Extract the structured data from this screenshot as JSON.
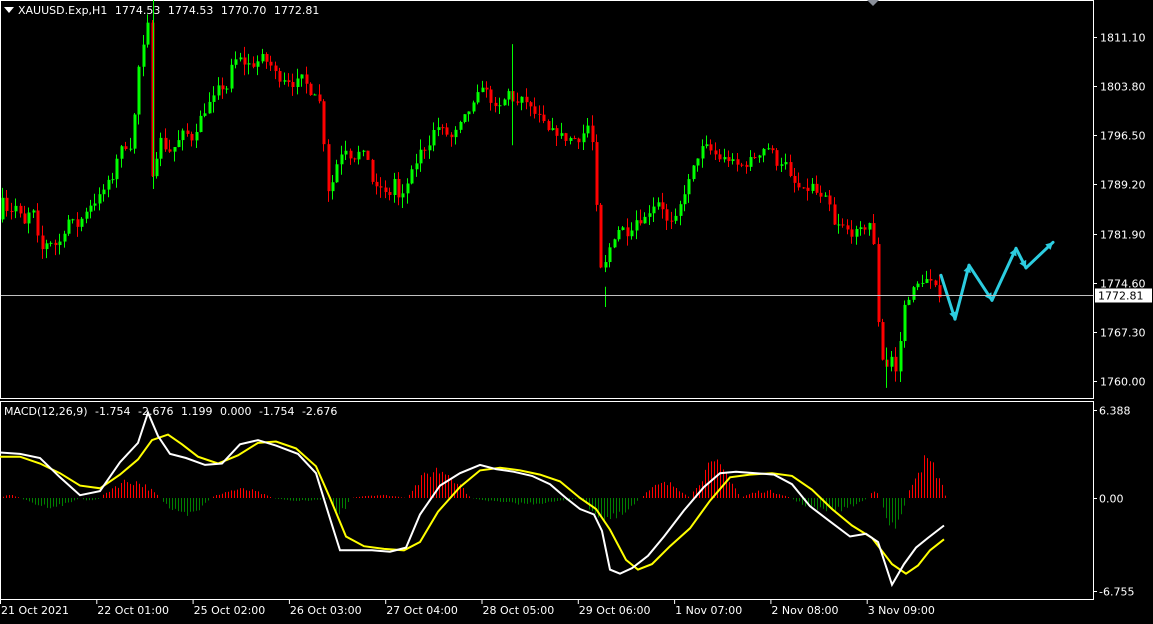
{
  "header": {
    "symbol": "XAUUSD.Exp,H1",
    "open": "1774.53",
    "high": "1774.53",
    "low": "1770.70",
    "close": "1772.81"
  },
  "indicator": {
    "name": "MACD(12,26,9)",
    "values": [
      "-1.754",
      "-2.676",
      "1.199",
      "0.000",
      "-1.754",
      "-2.676"
    ]
  },
  "colors": {
    "background": "#000000",
    "grid": "#ffffff",
    "bull_candle": "#00ff00",
    "bear_candle": "#ff0000",
    "bid_line": "#c0c0c0",
    "macd_line": "#ffffff",
    "signal_line": "#ffff00",
    "hist_positive": "#ff0000",
    "hist_negative": "#008000",
    "forecast_arrow": "#2ccde0"
  },
  "chart_data": [
    {
      "type": "candlestick",
      "symbol": "XAUUSD.Exp",
      "timeframe": "H1",
      "current_price": 1772.81,
      "current_price_label": "1772.81",
      "ylim": [
        1757.5,
        1816.4
      ],
      "y_tick_labels": [
        "1811.10",
        "1803.80",
        "1796.50",
        "1789.20",
        "1781.90",
        "1774.60",
        "1767.30",
        "1760.00"
      ],
      "x_tick_labels": [
        "21 Oct 2021",
        "22 Oct 01:00",
        "25 Oct 02:00",
        "26 Oct 03:00",
        "27 Oct 04:00",
        "28 Oct 05:00",
        "29 Oct 06:00",
        "1 Nov 07:00",
        "2 Nov 08:00",
        "3 Nov 09:00"
      ],
      "close_path": [
        [
          0,
          1782
        ],
        [
          6,
          1788
        ],
        [
          12,
          1785
        ],
        [
          20,
          1786
        ],
        [
          28,
          1783
        ],
        [
          36,
          1786
        ],
        [
          44,
          1779
        ],
        [
          52,
          1781
        ],
        [
          62,
          1780
        ],
        [
          72,
          1784
        ],
        [
          82,
          1783
        ],
        [
          92,
          1786
        ],
        [
          102,
          1787
        ],
        [
          110,
          1789
        ],
        [
          116,
          1790
        ],
        [
          122,
          1794
        ],
        [
          130,
          1795
        ],
        [
          136,
          1795
        ],
        [
          142,
          1806
        ],
        [
          148,
          1810
        ],
        [
          152,
          1813
        ],
        [
          154,
          1790
        ],
        [
          158,
          1792
        ],
        [
          164,
          1796
        ],
        [
          172,
          1794
        ],
        [
          180,
          1795
        ],
        [
          188,
          1797
        ],
        [
          196,
          1796
        ],
        [
          204,
          1799
        ],
        [
          212,
          1801
        ],
        [
          218,
          1802
        ],
        [
          224,
          1804
        ],
        [
          230,
          1803
        ],
        [
          236,
          1807
        ],
        [
          242,
          1808
        ],
        [
          250,
          1807
        ],
        [
          258,
          1807
        ],
        [
          266,
          1808
        ],
        [
          274,
          1807
        ],
        [
          282,
          1805
        ],
        [
          290,
          1805
        ],
        [
          298,
          1804
        ],
        [
          306,
          1805
        ],
        [
          314,
          1803
        ],
        [
          320,
          1803
        ],
        [
          326,
          1800
        ],
        [
          330,
          1789
        ],
        [
          334,
          1788
        ],
        [
          340,
          1792
        ],
        [
          348,
          1795
        ],
        [
          356,
          1793
        ],
        [
          364,
          1794
        ],
        [
          372,
          1793
        ],
        [
          378,
          1788
        ],
        [
          384,
          1789
        ],
        [
          392,
          1787
        ],
        [
          398,
          1790
        ],
        [
          404,
          1786
        ],
        [
          410,
          1789
        ],
        [
          416,
          1791
        ],
        [
          424,
          1794
        ],
        [
          432,
          1795
        ],
        [
          440,
          1798
        ],
        [
          448,
          1797
        ],
        [
          456,
          1796
        ],
        [
          464,
          1798
        ],
        [
          472,
          1800
        ],
        [
          478,
          1801
        ],
        [
          486,
          1804
        ],
        [
          494,
          1802
        ],
        [
          500,
          1800
        ],
        [
          506,
          1801
        ],
        [
          512,
          1803
        ],
        [
          520,
          1801
        ],
        [
          528,
          1802
        ],
        [
          536,
          1800
        ],
        [
          544,
          1799
        ],
        [
          552,
          1797
        ],
        [
          560,
          1797
        ],
        [
          568,
          1796
        ],
        [
          576,
          1796
        ],
        [
          584,
          1796
        ],
        [
          592,
          1798
        ],
        [
          598,
          1794
        ],
        [
          602,
          1780
        ],
        [
          606,
          1775
        ],
        [
          610,
          1778
        ],
        [
          616,
          1781
        ],
        [
          624,
          1783
        ],
        [
          632,
          1782
        ],
        [
          640,
          1784
        ],
        [
          648,
          1784
        ],
        [
          656,
          1786
        ],
        [
          664,
          1787
        ],
        [
          672,
          1783
        ],
        [
          680,
          1784
        ],
        [
          688,
          1788
        ],
        [
          694,
          1790
        ],
        [
          700,
          1793
        ],
        [
          708,
          1795
        ],
        [
          716,
          1794
        ],
        [
          724,
          1793
        ],
        [
          732,
          1793
        ],
        [
          740,
          1792
        ],
        [
          748,
          1792
        ],
        [
          756,
          1793
        ],
        [
          764,
          1794
        ],
        [
          770,
          1795
        ],
        [
          776,
          1794
        ],
        [
          782,
          1792
        ],
        [
          788,
          1793
        ],
        [
          794,
          1790
        ],
        [
          800,
          1789
        ],
        [
          808,
          1788
        ],
        [
          816,
          1789
        ],
        [
          824,
          1787
        ],
        [
          832,
          1787
        ],
        [
          838,
          1783
        ],
        [
          846,
          1783
        ],
        [
          854,
          1782
        ],
        [
          862,
          1782
        ],
        [
          870,
          1783
        ],
        [
          876,
          1784
        ],
        [
          880,
          1774
        ],
        [
          884,
          1764
        ],
        [
          888,
          1763
        ],
        [
          892,
          1762
        ],
        [
          896,
          1764
        ],
        [
          900,
          1761
        ],
        [
          904,
          1766
        ],
        [
          908,
          1771
        ],
        [
          914,
          1773
        ],
        [
          920,
          1774
        ],
        [
          926,
          1775
        ],
        [
          932,
          1775
        ],
        [
          938,
          1774
        ],
        [
          942,
          1773
        ]
      ],
      "forecast_path": [
        [
          941,
          1775.7
        ],
        [
          955,
          1769.2
        ],
        [
          969,
          1777.2
        ],
        [
          992,
          1772.0
        ],
        [
          1016,
          1779.7
        ],
        [
          1026,
          1776.8
        ],
        [
          1053,
          1780.6
        ]
      ]
    },
    {
      "type": "line",
      "name": "MACD(12,26,9)",
      "ylim": [
        -6.755,
        6.388
      ],
      "y_tick_labels": [
        "6.388",
        "0.00",
        "-6.755"
      ],
      "macd_path": [
        [
          0,
          3.3
        ],
        [
          20,
          3.2
        ],
        [
          40,
          2.9
        ],
        [
          60,
          1.5
        ],
        [
          80,
          0.2
        ],
        [
          100,
          0.5
        ],
        [
          120,
          2.6
        ],
        [
          138,
          4.0
        ],
        [
          148,
          6.2
        ],
        [
          158,
          4.5
        ],
        [
          170,
          3.2
        ],
        [
          186,
          2.9
        ],
        [
          205,
          2.4
        ],
        [
          222,
          2.5
        ],
        [
          240,
          3.9
        ],
        [
          258,
          4.2
        ],
        [
          276,
          3.8
        ],
        [
          298,
          3.2
        ],
        [
          316,
          1.8
        ],
        [
          330,
          -1.5
        ],
        [
          340,
          -3.8
        ],
        [
          356,
          -3.8
        ],
        [
          372,
          -3.8
        ],
        [
          390,
          -3.9
        ],
        [
          406,
          -3.6
        ],
        [
          420,
          -1.2
        ],
        [
          440,
          0.9
        ],
        [
          460,
          1.8
        ],
        [
          480,
          2.4
        ],
        [
          496,
          2.1
        ],
        [
          514,
          1.9
        ],
        [
          532,
          1.6
        ],
        [
          550,
          1.0
        ],
        [
          566,
          0.0
        ],
        [
          580,
          -0.8
        ],
        [
          594,
          -1.2
        ],
        [
          602,
          -2.4
        ],
        [
          610,
          -5.2
        ],
        [
          620,
          -5.5
        ],
        [
          632,
          -5.1
        ],
        [
          648,
          -4.2
        ],
        [
          664,
          -2.8
        ],
        [
          684,
          -0.9
        ],
        [
          704,
          0.8
        ],
        [
          720,
          1.8
        ],
        [
          736,
          1.9
        ],
        [
          756,
          1.8
        ],
        [
          774,
          1.7
        ],
        [
          792,
          1.0
        ],
        [
          810,
          -0.6
        ],
        [
          830,
          -1.7
        ],
        [
          850,
          -2.8
        ],
        [
          866,
          -2.6
        ],
        [
          878,
          -3.2
        ],
        [
          892,
          -6.3
        ],
        [
          904,
          -4.8
        ],
        [
          916,
          -3.6
        ],
        [
          928,
          -2.9
        ],
        [
          944,
          -2.0
        ]
      ],
      "signal_path": [
        [
          0,
          3.0
        ],
        [
          20,
          3.0
        ],
        [
          40,
          2.5
        ],
        [
          60,
          1.8
        ],
        [
          80,
          0.9
        ],
        [
          100,
          0.7
        ],
        [
          120,
          1.7
        ],
        [
          138,
          2.8
        ],
        [
          152,
          4.2
        ],
        [
          168,
          4.6
        ],
        [
          182,
          3.9
        ],
        [
          198,
          3.0
        ],
        [
          218,
          2.5
        ],
        [
          238,
          3.1
        ],
        [
          258,
          4.0
        ],
        [
          276,
          4.1
        ],
        [
          296,
          3.6
        ],
        [
          316,
          2.3
        ],
        [
          330,
          0.0
        ],
        [
          346,
          -2.8
        ],
        [
          364,
          -3.5
        ],
        [
          384,
          -3.7
        ],
        [
          404,
          -3.8
        ],
        [
          420,
          -3.2
        ],
        [
          438,
          -1.0
        ],
        [
          460,
          0.8
        ],
        [
          480,
          2.0
        ],
        [
          500,
          2.2
        ],
        [
          520,
          2.0
        ],
        [
          540,
          1.7
        ],
        [
          560,
          1.2
        ],
        [
          580,
          0.0
        ],
        [
          596,
          -0.8
        ],
        [
          610,
          -2.3
        ],
        [
          626,
          -4.5
        ],
        [
          638,
          -5.2
        ],
        [
          652,
          -4.8
        ],
        [
          670,
          -3.5
        ],
        [
          690,
          -2.2
        ],
        [
          710,
          -0.2
        ],
        [
          730,
          1.5
        ],
        [
          750,
          1.7
        ],
        [
          772,
          1.8
        ],
        [
          792,
          1.6
        ],
        [
          812,
          0.6
        ],
        [
          832,
          -0.8
        ],
        [
          852,
          -2.0
        ],
        [
          872,
          -2.9
        ],
        [
          892,
          -4.8
        ],
        [
          906,
          -5.5
        ],
        [
          918,
          -4.9
        ],
        [
          930,
          -3.8
        ],
        [
          944,
          -3.0
        ]
      ],
      "histogram_segments": [
        {
          "from": 0,
          "to": 20,
          "value": 0.2
        },
        {
          "from": 20,
          "to": 80,
          "value": -0.6
        },
        {
          "from": 80,
          "to": 100,
          "value": -0.2
        },
        {
          "from": 100,
          "to": 160,
          "value": 1.2
        },
        {
          "from": 160,
          "to": 210,
          "value": -1.3
        },
        {
          "from": 210,
          "to": 272,
          "value": 0.6
        },
        {
          "from": 272,
          "to": 330,
          "value": -0.2
        },
        {
          "from": 330,
          "to": 350,
          "value": -1.0
        },
        {
          "from": 350,
          "to": 406,
          "value": 0.2
        },
        {
          "from": 406,
          "to": 470,
          "value": 2.0
        },
        {
          "from": 470,
          "to": 580,
          "value": -0.4
        },
        {
          "from": 580,
          "to": 640,
          "value": -1.5
        },
        {
          "from": 640,
          "to": 690,
          "value": 1.0
        },
        {
          "from": 690,
          "to": 740,
          "value": 2.3
        },
        {
          "from": 740,
          "to": 790,
          "value": 0.5
        },
        {
          "from": 790,
          "to": 868,
          "value": -0.9
        },
        {
          "from": 868,
          "to": 880,
          "value": 0.4
        },
        {
          "from": 880,
          "to": 906,
          "value": -2.2
        },
        {
          "from": 906,
          "to": 946,
          "value": 2.6
        }
      ]
    }
  ]
}
